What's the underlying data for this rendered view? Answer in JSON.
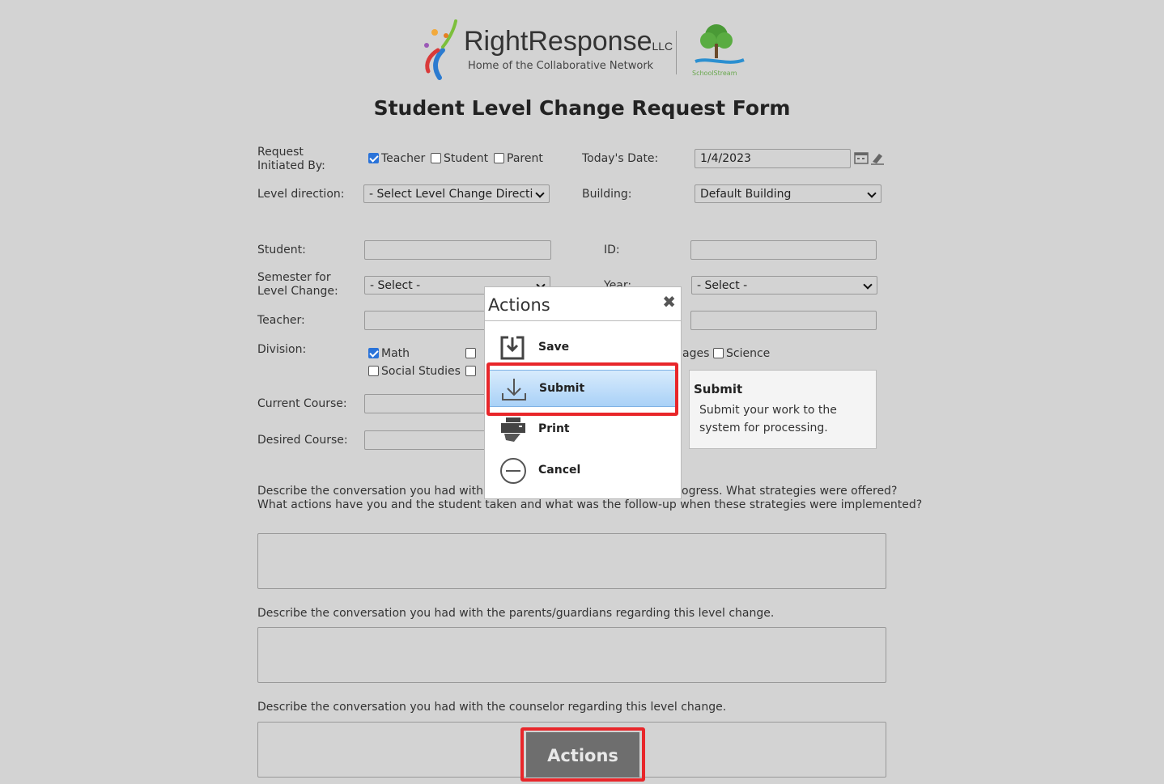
{
  "logo": {
    "brand": "RightResponse",
    "brand_suffix": "LLC",
    "tagline": "Home of the Collaborative Network",
    "partner": "SchoolStream"
  },
  "form_title": "Student Level Change Request Form",
  "fields": {
    "request_initiated_by_label": "Request Initiated By:",
    "initiator_options": [
      {
        "label": "Teacher",
        "checked": true
      },
      {
        "label": "Student",
        "checked": false
      },
      {
        "label": "Parent",
        "checked": false
      }
    ],
    "todays_date_label": "Today's Date:",
    "todays_date_value": "1/4/2023",
    "level_direction_label": "Level direction:",
    "level_direction_value": "- Select Level Change Directi",
    "building_label": "Building:",
    "building_value": "Default Building",
    "student_label": "Student:",
    "student_value": "",
    "id_label": "ID:",
    "id_value": "",
    "semester_label": "Semester for Level Change:",
    "semester_value": "- Select -",
    "year_label": "Year:",
    "year_value": "- Select -",
    "teacher_label": "Teacher:",
    "teacher_value": "",
    "division_label": "Division:",
    "divisions": [
      {
        "label": "Math",
        "checked": true
      },
      {
        "label": "Social Studies",
        "checked": false
      },
      {
        "label": "ages",
        "checked": false
      },
      {
        "label": "Science",
        "checked": false
      }
    ],
    "current_course_label": "Current Course:",
    "desired_course_label": "Desired Course:"
  },
  "questions": {
    "q1_line1_a": "Describe the conversation you had with",
    "q1_line1_b": "ogress. What strategies were offered?",
    "q1_line2": "What actions have you and the student taken and what was the follow-up when these strategies were implemented?",
    "q2": "Describe the conversation you had with the parents/guardians regarding this level change.",
    "q3": "Describe the conversation you had with the counselor regarding this level change."
  },
  "actions_popup": {
    "title": "Actions",
    "items": [
      {
        "label": "Save",
        "icon": "save-icon"
      },
      {
        "label": "Submit",
        "icon": "submit-download-icon"
      },
      {
        "label": "Print",
        "icon": "printer-icon"
      },
      {
        "label": "Cancel",
        "icon": "cancel-circle-icon"
      }
    ]
  },
  "tooltip": {
    "title": "Submit",
    "body": "Submit your work to the system for processing."
  },
  "actions_button": "Actions",
  "colors": {
    "background": "#d3d3d3",
    "highlight_red": "#e8262a",
    "checkbox_blue": "#2a73d9",
    "actions_button_bg": "#6e6e6e"
  }
}
